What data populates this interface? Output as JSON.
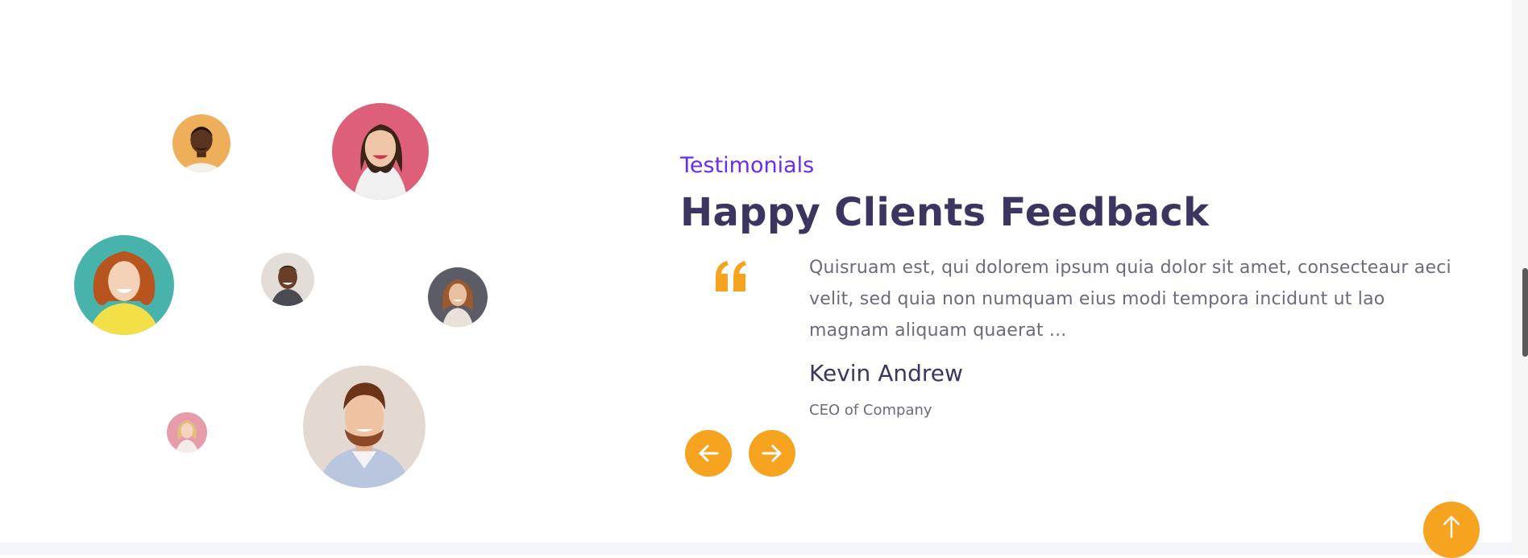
{
  "testimonials": {
    "eyebrow": "Testimonials",
    "title": "Happy Clients Feedback",
    "quote_icon": "quote-icon",
    "quote": "Quisruam est, qui dolorem ipsum quia dolor sit amet, consecteaur aeci velit, sed quia non numquam eius modi tempora incidunt ut lao magnam aliquam quaerat ...",
    "author_name": "Kevin Andrew",
    "author_role": "CEO of Company",
    "prev_icon": "arrow-left-icon",
    "next_icon": "arrow-right-icon"
  },
  "avatars": [
    {
      "name": "avatar-client-1",
      "bg": "#eeae5a"
    },
    {
      "name": "avatar-client-2",
      "bg": "#de5f7a"
    },
    {
      "name": "avatar-client-3",
      "bg": "#47b3aa"
    },
    {
      "name": "avatar-client-4",
      "bg": "#e4ddd7"
    },
    {
      "name": "avatar-client-5",
      "bg": "#5c5c66"
    },
    {
      "name": "avatar-client-6",
      "bg": "#e79cab"
    },
    {
      "name": "avatar-client-7",
      "bg": "#e3d9d1"
    }
  ],
  "back_to_top_icon": "arrow-up-icon",
  "colors": {
    "accent": "#f6a31f",
    "eyebrow": "#6c2bf0",
    "heading": "#3b3560",
    "body_text": "#6b6b7b"
  }
}
